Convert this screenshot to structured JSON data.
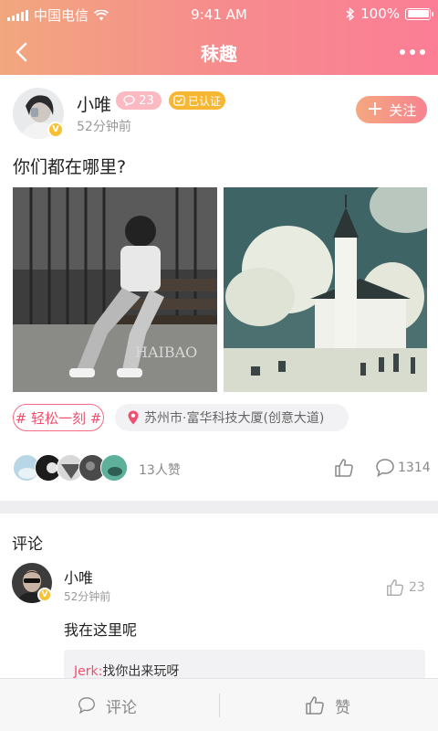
{
  "status_bar": {
    "carrier": "中国电信",
    "time": "9:41 AM",
    "battery": "100%"
  },
  "nav": {
    "title": "秣趣"
  },
  "post": {
    "author": "小唯",
    "comment_badge_count": "23",
    "verified_label": "已认证",
    "badge_letter": "V",
    "time_ago": "52分钟前",
    "follow_label": "关注",
    "text": "你们都在哪里?",
    "photo_watermark": "HAIBAO",
    "topic_tag": "# 轻松一刻 #",
    "location": "苏州市·富华科技大厦(创意大道)",
    "likes_text": "13人赞",
    "comment_count": "1314"
  },
  "comments": {
    "section_title": "评论",
    "items": [
      {
        "author": "小唯",
        "time_ago": "52分钟前",
        "like_count": "23",
        "text": "我在这里呢",
        "reply": {
          "user": "Jerk:",
          "text": "找你出来玩呀"
        }
      }
    ]
  },
  "bottom_bar": {
    "comment_label": "评论",
    "like_label": "赞"
  },
  "colors": {
    "header_gradient_start": "#f2a77e",
    "header_gradient_end": "#fb7d96",
    "accent_pink": "#f0506e",
    "verified_gold": "#f7b733"
  },
  "icons": [
    "back-arrow-icon",
    "more-dots-icon",
    "chat-bubble-icon",
    "verified-icon",
    "plus-icon",
    "location-pin-icon",
    "thumbs-up-icon",
    "comment-icon"
  ]
}
